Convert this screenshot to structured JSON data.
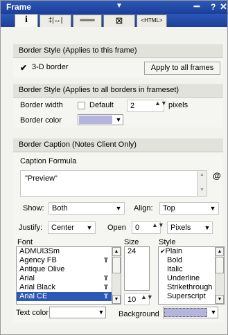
{
  "titlebar": {
    "title": "Frame",
    "dropdown_glyph": "▼",
    "grip_glyph": "▪▪▪▪",
    "help_glyph": "?",
    "close_glyph": "✕"
  },
  "tabs": [
    {
      "label": "i",
      "icon": "info-icon",
      "selected": true
    },
    {
      "label": "‡|↔|",
      "icon": "size-icon",
      "selected": false
    },
    {
      "label": "═══",
      "icon": "border-icon",
      "selected": false
    },
    {
      "label": "⊠",
      "icon": "advanced-icon",
      "selected": false
    },
    {
      "label": "<HTML>",
      "icon": "html-icon",
      "selected": false
    }
  ],
  "border_style_frame": {
    "heading": "Border Style  (Applies to this frame)",
    "checkbox_label": "3-D border",
    "checkbox_checked": true,
    "check_glyph": "✔",
    "apply_all_label": "Apply to all frames"
  },
  "border_style_frameset": {
    "heading": "Border Style  (Applies to all borders in frameset)",
    "width_label": "Border width",
    "default_label": "Default",
    "default_checked": false,
    "width_value": "2",
    "pixels_label": "pixels",
    "color_label": "Border color",
    "color_swatch": "#b4b4dc"
  },
  "border_caption": {
    "heading": "Border Caption  (Notes Client Only)",
    "formula_label": "Caption Formula",
    "formula_value": "\"Preview\"",
    "formula_button": "@",
    "show_label": "Show:",
    "show_value": "Both",
    "align_label": "Align:",
    "align_value": "Top",
    "justify_label": "Justify:",
    "justify_value": "Center",
    "open_label": "Open",
    "open_value": "0",
    "open_unit": "Pixels",
    "font_label": "Font",
    "fonts": [
      {
        "name": "ADMUI3Sm",
        "truetype": false,
        "selected": false
      },
      {
        "name": "Agency FB",
        "truetype": true,
        "selected": false
      },
      {
        "name": "Antique Olive",
        "truetype": false,
        "selected": false
      },
      {
        "name": "Arial",
        "truetype": true,
        "selected": false
      },
      {
        "name": "Arial Black",
        "truetype": true,
        "selected": false
      },
      {
        "name": "Arial CE",
        "truetype": true,
        "selected": true
      }
    ],
    "truetype_glyph": "T",
    "size_label": "Size",
    "size_selected": "24",
    "size_value": "10",
    "style_label": "Style",
    "styles": [
      {
        "name": "Plain",
        "checked": true
      },
      {
        "name": "Bold",
        "checked": false
      },
      {
        "name": "Italic",
        "checked": false
      },
      {
        "name": "Underline",
        "checked": false
      },
      {
        "name": "Strikethrough",
        "checked": false
      },
      {
        "name": "Superscript",
        "checked": false
      }
    ],
    "style_check_glyph": "✔",
    "text_color_label": "Text color",
    "background_label": "Background",
    "background_swatch": "#b4b4dc"
  },
  "glyphs": {
    "dropdown": "▼",
    "spin": "▲▼",
    "scroll_up": "▲",
    "scroll_down": "▼"
  }
}
